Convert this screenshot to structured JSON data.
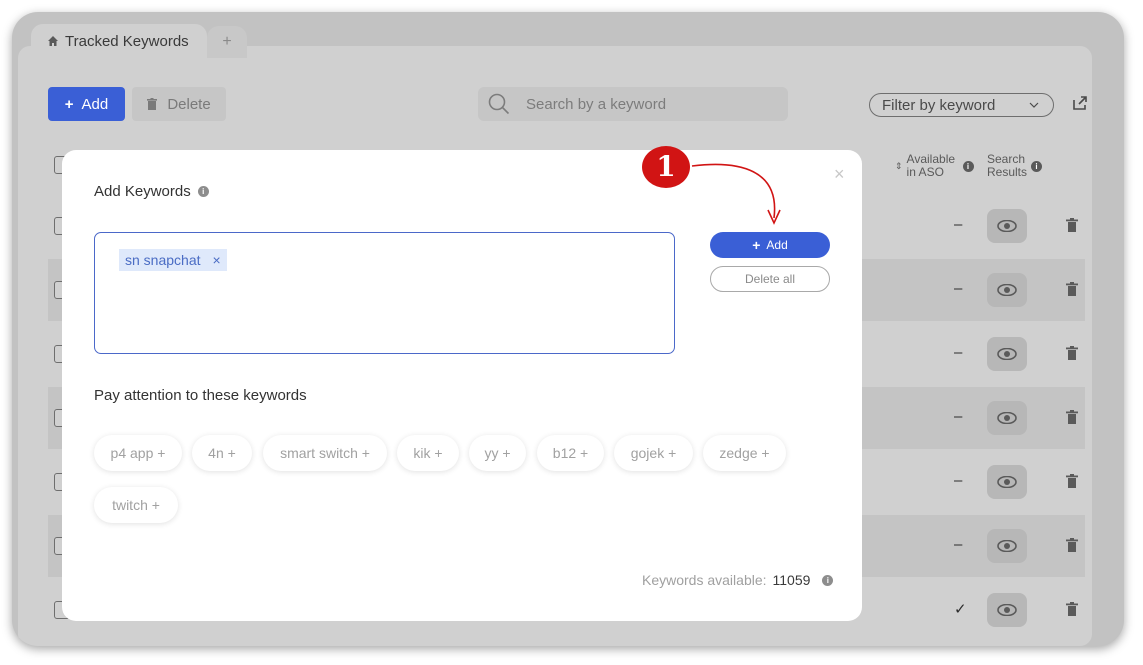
{
  "tabs": {
    "active_label": "Tracked Keywords",
    "new_tab_label": "+"
  },
  "toolbar": {
    "add_label": "Add",
    "delete_label": "Delete",
    "search_placeholder": "Search by a keyword",
    "filter_label": "Filter by keyword"
  },
  "table_header": {
    "available_label": "Available in ASO",
    "search_results_label": "Search Results"
  },
  "rows": [
    {
      "available": "–"
    },
    {
      "available": "–"
    },
    {
      "available": "–"
    },
    {
      "available": "–"
    },
    {
      "available": "–"
    },
    {
      "available": "–"
    },
    {
      "available": "✓"
    }
  ],
  "modal": {
    "title": "Add Keywords",
    "close": "×",
    "entered_keyword": "sn snapchat",
    "chip_remove": "×",
    "add_label": "Add",
    "delete_all_label": "Delete all",
    "attention_label": "Pay attention to these keywords",
    "suggestions": [
      "p4 app +",
      "4n +",
      "smart switch +",
      "kik +",
      "yy +",
      "b12 +",
      "gojek +",
      "zedge +",
      "twitch +"
    ],
    "available_label": "Keywords available:",
    "available_count": "11059"
  },
  "annotation": {
    "step_number": "1",
    "color": "#d11414"
  },
  "colors": {
    "primary": "#3a5fd6",
    "chip_bg": "#dfe9fb",
    "chip_text": "#4a6cc4"
  }
}
